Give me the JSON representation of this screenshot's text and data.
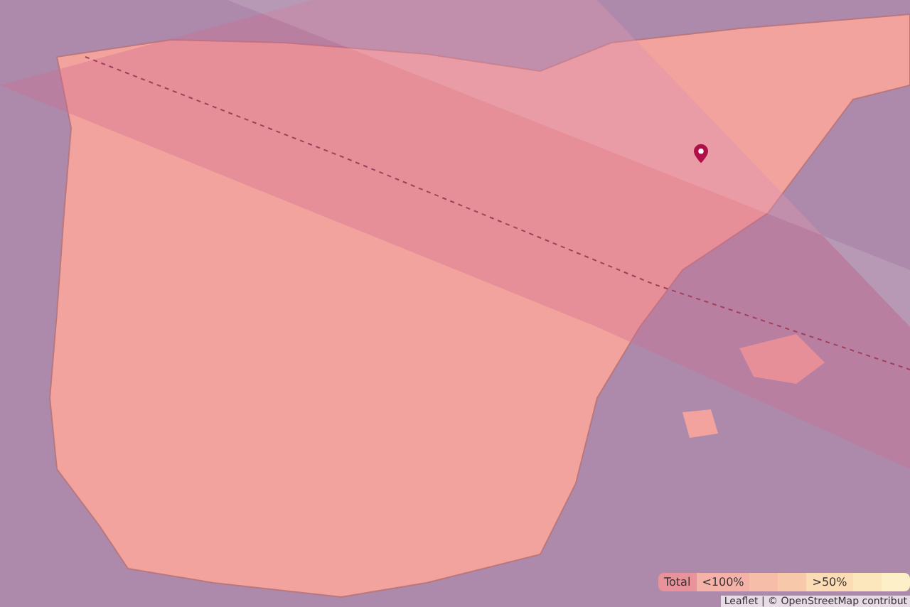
{
  "legend": {
    "segments": [
      {
        "label": "Total",
        "color": "#e8939c"
      },
      {
        "label": "<100%",
        "color": "#f4b2a8"
      },
      {
        "color": "#f6bea8"
      },
      {
        "color": "#f8c8aa"
      },
      {
        "label": ">50%",
        "color": "#fbdcb4"
      },
      {
        "color": "#fce6bc"
      },
      {
        "color": "#fdf0c8"
      }
    ]
  },
  "attribution": "Leaflet | © OpenStreetMap contribut"
}
